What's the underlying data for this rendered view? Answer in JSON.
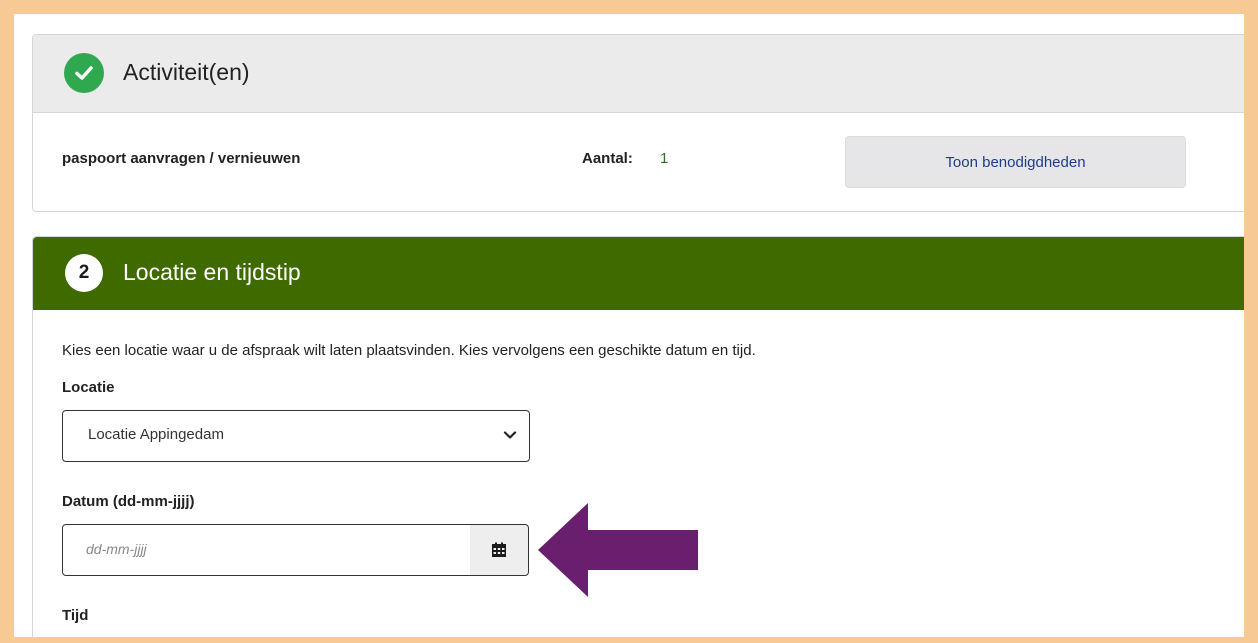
{
  "step1": {
    "title": "Activiteit(en)",
    "activity_name": "paspoort aanvragen / vernieuwen",
    "quantity_label": "Aantal:",
    "quantity_value": "1",
    "requirements_button": "Toon benodigdheden"
  },
  "step2": {
    "number": "2",
    "title": "Locatie en tijdstip",
    "intro": "Kies een locatie waar u de afspraak wilt laten plaatsvinden. Kies vervolgens een geschikte datum en tijd.",
    "location_label": "Locatie",
    "location_value": "Locatie Appingedam",
    "date_label": "Datum (dd-mm-jjjj)",
    "date_placeholder": "dd-mm-jjjj",
    "time_label": "Tijd"
  },
  "colors": {
    "frame": "#f7c995",
    "step2_header": "#3f6a00",
    "check": "#2fa84f",
    "arrow": "#6a1f6e"
  },
  "icons": {
    "check": "check-icon",
    "chevron": "chevron-down-icon",
    "calendar": "calendar-icon",
    "arrow": "arrow-left-icon"
  }
}
